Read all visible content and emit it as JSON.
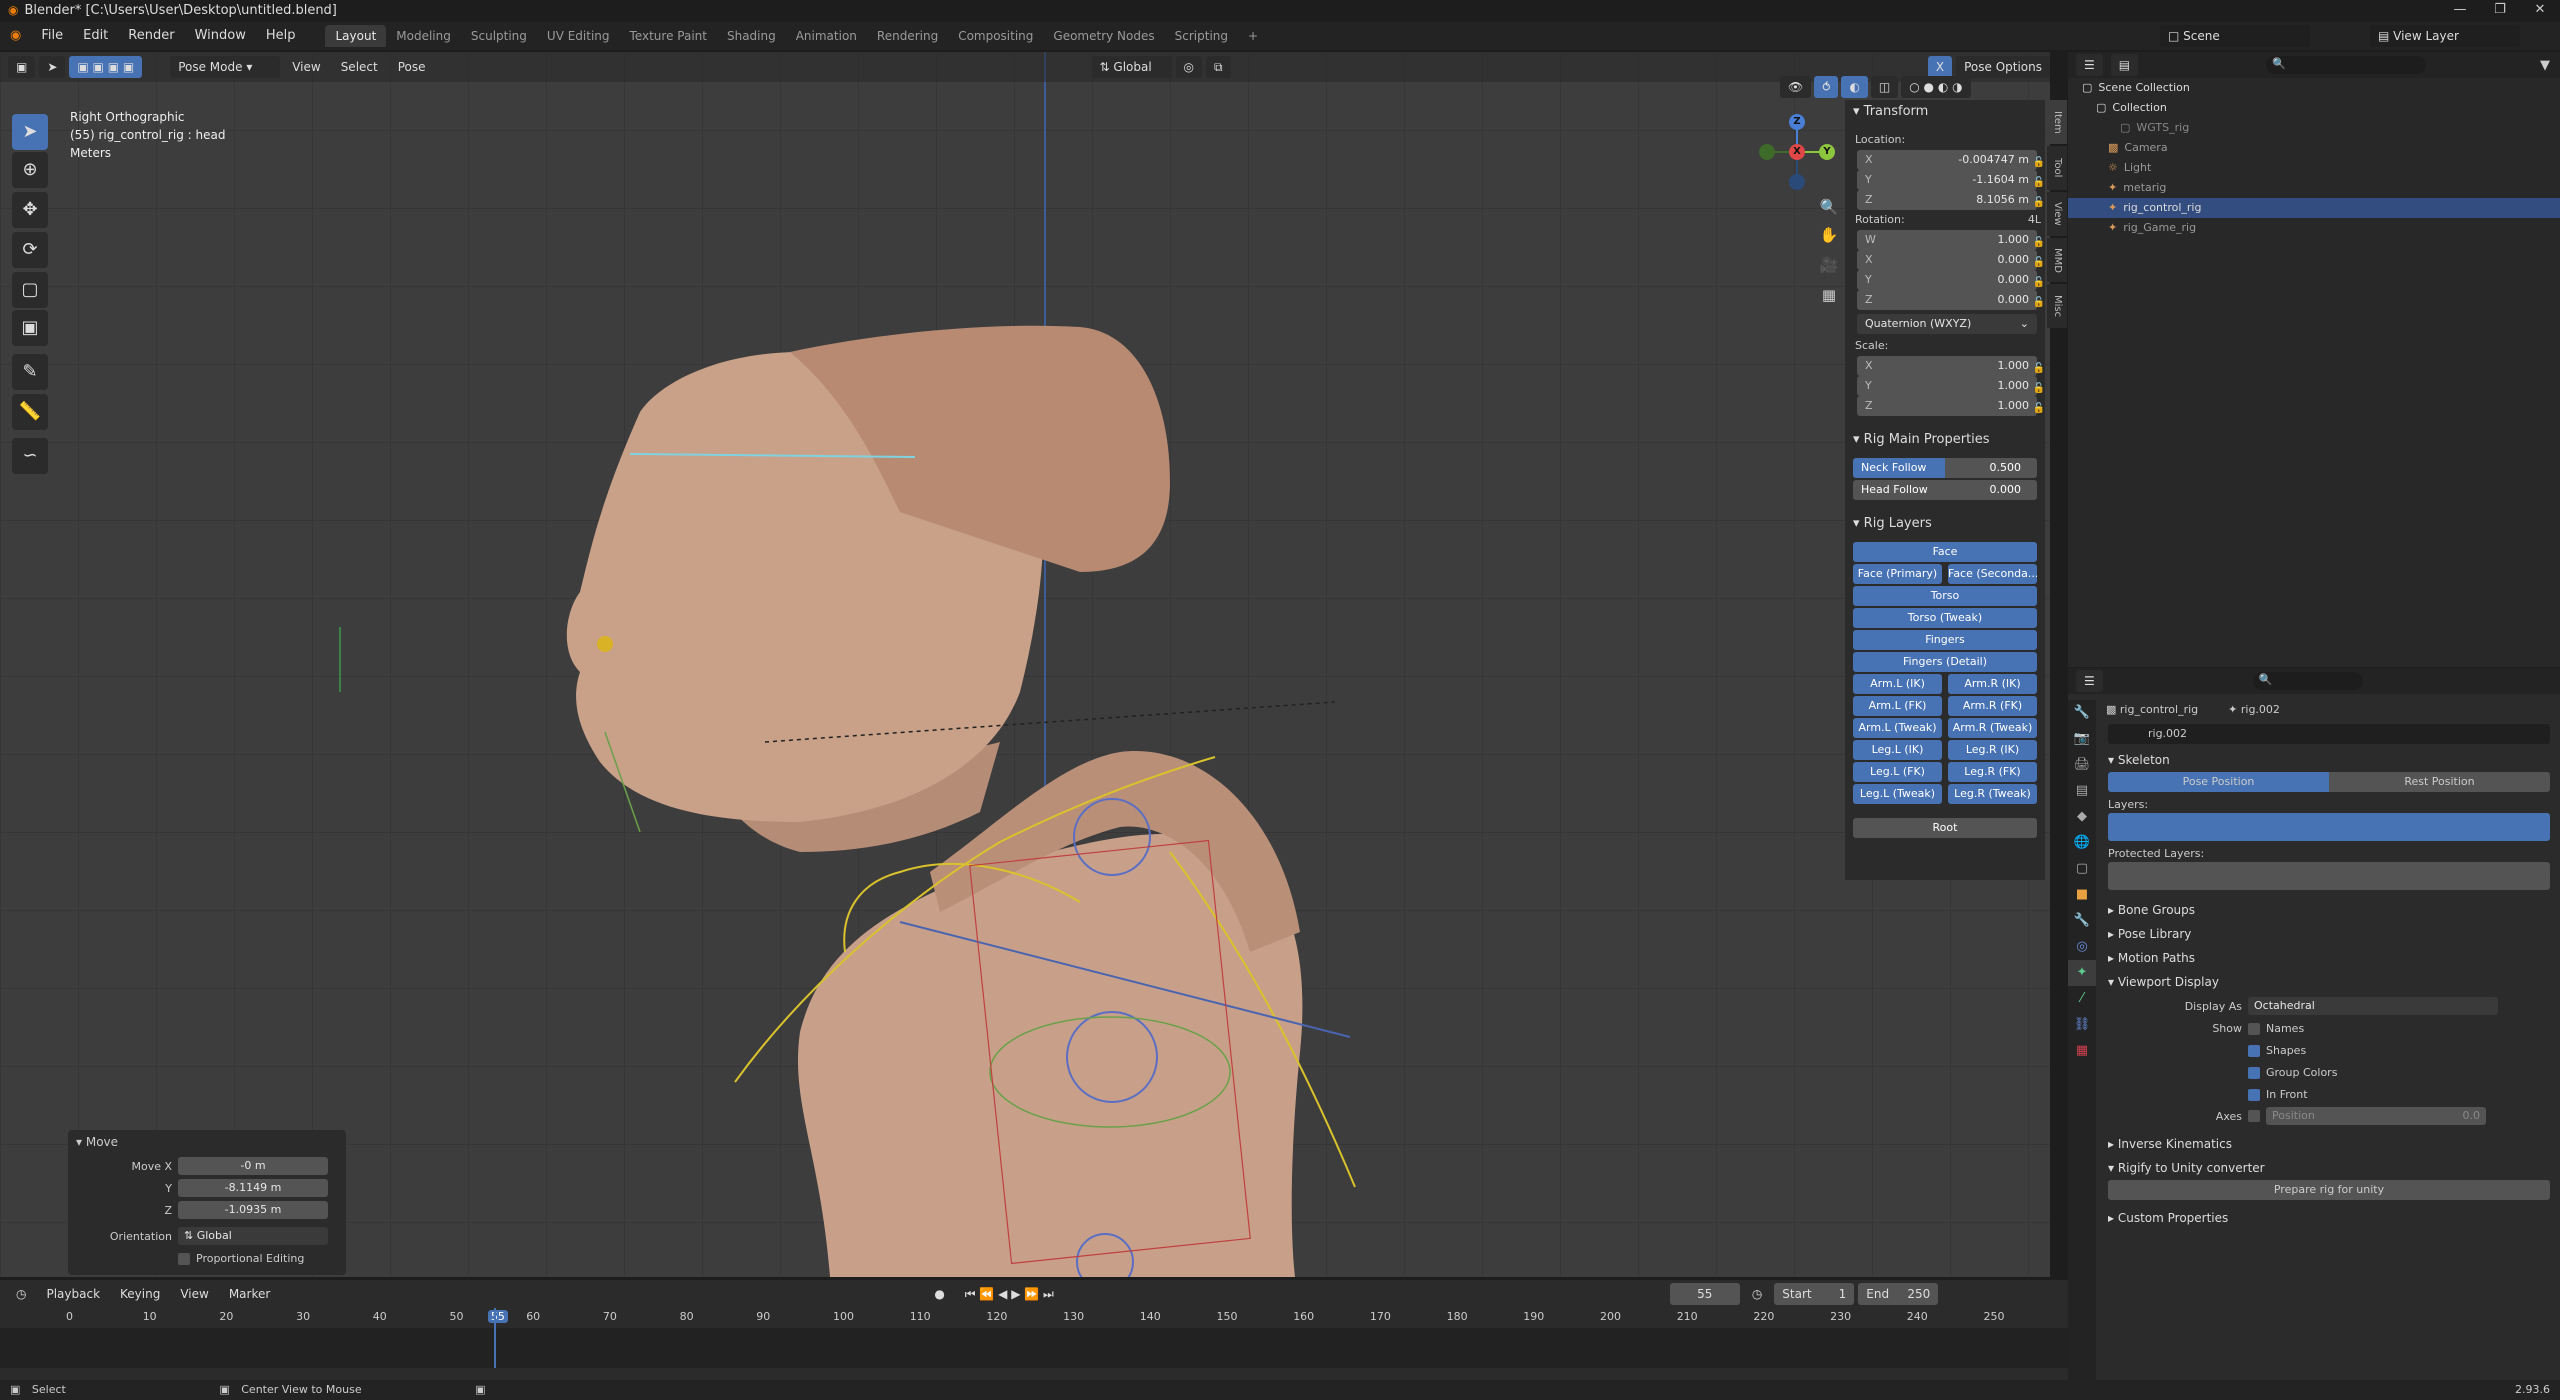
{
  "window": {
    "title": "Blender* [C:\\Users\\User\\Desktop\\untitled.blend]"
  },
  "menus": [
    "File",
    "Edit",
    "Render",
    "Window",
    "Help"
  ],
  "workspaces": [
    "Layout",
    "Modeling",
    "Sculpting",
    "UV Editing",
    "Texture Paint",
    "Shading",
    "Animation",
    "Rendering",
    "Compositing",
    "Geometry Nodes",
    "Scripting"
  ],
  "active_workspace": "Layout",
  "scene": {
    "name": "Scene",
    "view_layer": "View Layer"
  },
  "viewport": {
    "mode": "Pose Mode",
    "menus": [
      "View",
      "Select",
      "Pose"
    ],
    "orientation": "Global",
    "pose_options": "Pose Options",
    "info": {
      "view": "Right Orthographic",
      "object": "(55) rig_control_rig : head",
      "units": "Meters"
    }
  },
  "npanel": {
    "tabs": [
      "Item",
      "Tool",
      "View",
      "MMD",
      "Misc"
    ],
    "transform_title": "Transform",
    "location_label": "Location:",
    "location": [
      {
        "ax": "X",
        "v": "-0.004747 m"
      },
      {
        "ax": "Y",
        "v": "-1.1604 m"
      },
      {
        "ax": "Z",
        "v": "8.1056 m"
      }
    ],
    "rotation_label": "Rotation:",
    "rotation_mode_tag": "4L",
    "rotation": [
      {
        "ax": "W",
        "v": "1.000"
      },
      {
        "ax": "X",
        "v": "0.000"
      },
      {
        "ax": "Y",
        "v": "0.000"
      },
      {
        "ax": "Z",
        "v": "0.000"
      }
    ],
    "rotation_mode": "Quaternion (WXYZ)",
    "scale_label": "Scale:",
    "scale": [
      {
        "ax": "X",
        "v": "1.000"
      },
      {
        "ax": "Y",
        "v": "1.000"
      },
      {
        "ax": "Z",
        "v": "1.000"
      }
    ],
    "rig_main_title": "Rig Main Properties",
    "neck_follow": {
      "label": "Neck Follow",
      "value": "0.500",
      "fraction": 0.5
    },
    "head_follow": {
      "label": "Head Follow",
      "value": "0.000",
      "fraction": 0.0
    },
    "rig_layers_title": "Rig Layers",
    "layers": {
      "face": "Face",
      "face_primary": "Face (Primary)",
      "face_secondary": "Face (Seconda...",
      "torso": "Torso",
      "torso_tweak": "Torso (Tweak)",
      "fingers": "Fingers",
      "fingers_detail": "Fingers (Detail)",
      "arm_l_ik": "Arm.L (IK)",
      "arm_r_ik": "Arm.R (IK)",
      "arm_l_fk": "Arm.L (FK)",
      "arm_r_fk": "Arm.R (FK)",
      "arm_l_tweak": "Arm.L (Tweak)",
      "arm_r_tweak": "Arm.R (Tweak)",
      "leg_l_ik": "Leg.L (IK)",
      "leg_r_ik": "Leg.R (IK)",
      "leg_l_fk": "Leg.L (FK)",
      "leg_r_fk": "Leg.R (FK)",
      "leg_l_tweak": "Leg.L (Tweak)",
      "leg_r_tweak": "Leg.R (Tweak)",
      "root": "Root"
    }
  },
  "operator": {
    "title": "Move",
    "move_x_label": "Move X",
    "move_x": "-0 m",
    "y_label": "Y",
    "y": "-8.1149 m",
    "z_label": "Z",
    "z": "-1.0935 m",
    "orientation_label": "Orientation",
    "orientation": "Global",
    "proportional": "Proportional Editing"
  },
  "outliner": {
    "scene_collection": "Scene Collection",
    "collection": "Collection",
    "items": [
      "WGTS_rig",
      "Camera",
      "Light",
      "metarig",
      "rig_control_rig",
      "rig_Game_rig"
    ]
  },
  "properties": {
    "object": "rig_control_rig",
    "armature": "rig.002",
    "data_name": "rig.002",
    "skeleton": "Skeleton",
    "pose_position": "Pose Position",
    "rest_position": "Rest Position",
    "layers_label": "Layers:",
    "protected_label": "Protected Layers:",
    "sections": [
      "Bone Groups",
      "Pose Library",
      "Motion Paths"
    ],
    "viewport_display": "Viewport Display",
    "display_as_label": "Display As",
    "display_as": "Octahedral",
    "show_label": "Show",
    "show_options": [
      {
        "label": "Names",
        "on": false
      },
      {
        "label": "Shapes",
        "on": true
      },
      {
        "label": "Group Colors",
        "on": true
      },
      {
        "label": "In Front",
        "on": true
      }
    ],
    "axes_label": "Axes",
    "axes_position": "Position",
    "axes_value": "0.0",
    "ik": "Inverse Kinematics",
    "rigify_converter": "Rigify to Unity converter",
    "prepare_btn": "Prepare rig for unity",
    "custom": "Custom Properties"
  },
  "timeline": {
    "menus": [
      "Playback",
      "Keying",
      "View",
      "Marker"
    ],
    "current_frame": "55",
    "start_label": "Start",
    "start": "1",
    "end_label": "End",
    "end": "250",
    "ticks": [
      "0",
      "10",
      "20",
      "30",
      "40",
      "50",
      "55",
      "60",
      "70",
      "80",
      "90",
      "100",
      "110",
      "120",
      "130",
      "140",
      "150",
      "160",
      "170",
      "180",
      "190",
      "200",
      "210",
      "220",
      "230",
      "240",
      "250"
    ]
  },
  "status": {
    "select": "Select",
    "center": "Center View to Mouse",
    "version": "2.93.6"
  },
  "colors": {
    "accent": "#4772b3",
    "viewport": "#3d3d3d",
    "skin": "#c9a088"
  }
}
